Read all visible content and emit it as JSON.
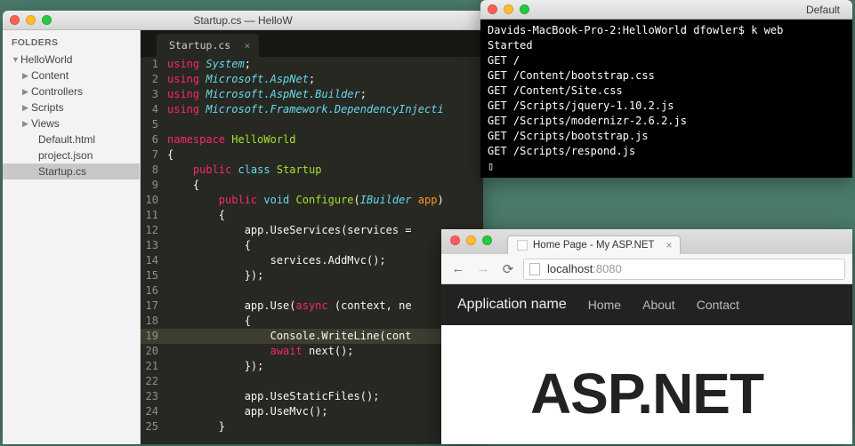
{
  "editor": {
    "window_title": "Startup.cs — HelloW",
    "sidebar_header": "FOLDERS",
    "tree": {
      "root": "HelloWorld",
      "folders": [
        "Content",
        "Controllers",
        "Scripts",
        "Views"
      ],
      "files": [
        "Default.html",
        "project.json",
        "Startup.cs"
      ],
      "selected": "Startup.cs"
    },
    "tab": "Startup.cs",
    "lines": [
      [
        {
          "t": "using ",
          "c": "kw"
        },
        {
          "t": "System",
          "c": "type"
        },
        {
          "t": ";",
          "c": ""
        }
      ],
      [
        {
          "t": "using ",
          "c": "kw"
        },
        {
          "t": "Microsoft.AspNet",
          "c": "type"
        },
        {
          "t": ";",
          "c": ""
        }
      ],
      [
        {
          "t": "using ",
          "c": "kw"
        },
        {
          "t": "Microsoft.AspNet.Builder",
          "c": "type"
        },
        {
          "t": ";",
          "c": ""
        }
      ],
      [
        {
          "t": "using ",
          "c": "kw"
        },
        {
          "t": "Microsoft.Framework.DependencyInjecti",
          "c": "type"
        }
      ],
      [],
      [
        {
          "t": "namespace ",
          "c": "kw"
        },
        {
          "t": "HelloWorld",
          "c": "nm"
        }
      ],
      [
        {
          "t": "{",
          "c": ""
        }
      ],
      [
        {
          "t": "    ",
          "c": ""
        },
        {
          "t": "public ",
          "c": "kw"
        },
        {
          "t": "class ",
          "c": "fn"
        },
        {
          "t": "Startup",
          "c": "nm"
        }
      ],
      [
        {
          "t": "    {",
          "c": ""
        }
      ],
      [
        {
          "t": "        ",
          "c": ""
        },
        {
          "t": "public ",
          "c": "kw"
        },
        {
          "t": "void ",
          "c": "fn"
        },
        {
          "t": "Configure",
          "c": "nm"
        },
        {
          "t": "(",
          "c": ""
        },
        {
          "t": "IBuilder ",
          "c": "type"
        },
        {
          "t": "app",
          "c": "param"
        },
        {
          "t": ")",
          "c": ""
        }
      ],
      [
        {
          "t": "        {",
          "c": ""
        }
      ],
      [
        {
          "t": "            app.UseServices(services =",
          "c": ""
        }
      ],
      [
        {
          "t": "            {",
          "c": ""
        }
      ],
      [
        {
          "t": "                services.AddMvc();",
          "c": ""
        }
      ],
      [
        {
          "t": "            });",
          "c": ""
        }
      ],
      [],
      [
        {
          "t": "            app.Use(",
          "c": ""
        },
        {
          "t": "async",
          "c": "kw"
        },
        {
          "t": " (context, ne",
          "c": ""
        }
      ],
      [
        {
          "t": "            {",
          "c": ""
        }
      ],
      [
        {
          "t": "                Console.WriteLine(cont",
          "c": ""
        }
      ],
      [
        {
          "t": "                ",
          "c": ""
        },
        {
          "t": "await",
          "c": "kw"
        },
        {
          "t": " next();",
          "c": ""
        }
      ],
      [
        {
          "t": "            });",
          "c": ""
        }
      ],
      [],
      [
        {
          "t": "            app.UseStaticFiles();",
          "c": ""
        }
      ],
      [
        {
          "t": "            app.UseMvc();",
          "c": ""
        }
      ],
      [
        {
          "t": "        }",
          "c": ""
        }
      ]
    ],
    "highlighted_line": 19
  },
  "terminal": {
    "title": "Default",
    "prompt": "Davids-MacBook-Pro-2:HelloWorld dfowler$ ",
    "command": "k web",
    "output": [
      "Started",
      "GET /",
      "GET /Content/bootstrap.css",
      "GET /Content/Site.css",
      "GET /Scripts/jquery-1.10.2.js",
      "GET /Scripts/modernizr-2.6.2.js",
      "GET /Scripts/bootstrap.js",
      "GET /Scripts/respond.js"
    ],
    "cursor": "▯"
  },
  "browser": {
    "tab_title": "Home Page - My ASP.NET",
    "url_host": "localhost",
    "url_port": ":8080",
    "navbar": {
      "brand": "Application name",
      "links": [
        "Home",
        "About",
        "Contact"
      ]
    },
    "hero": "ASP.NET"
  }
}
